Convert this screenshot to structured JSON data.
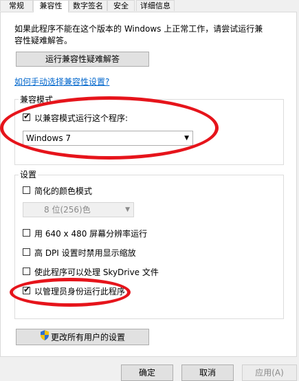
{
  "tabs": [
    {
      "label": "常规"
    },
    {
      "label": "兼容性"
    },
    {
      "label": "数字签名"
    },
    {
      "label": "安全"
    },
    {
      "label": "详细信息"
    }
  ],
  "intro": {
    "line1": "如果此程序不能在这个版本的 Windows 上正常工作，请尝试运行兼",
    "line2": "容性疑难解答。"
  },
  "troubleshoot_button": "运行兼容性疑难解答",
  "manual_link": "如何手动选择兼容性设置?",
  "compat_mode": {
    "title": "兼容模式",
    "checkbox_label": "以兼容模式运行这个程序:",
    "checked": true,
    "os_selected": "Windows 7"
  },
  "settings": {
    "title": "设置",
    "reduced_color": {
      "label": "简化的颜色模式",
      "checked": false
    },
    "color_select": "8 位(256)色",
    "res_640": {
      "label": "用 640 x 480 屏幕分辨率运行",
      "checked": false
    },
    "high_dpi": {
      "label": "高 DPI 设置时禁用显示缩放",
      "checked": false
    },
    "skydrive": {
      "label": "使此程序可以处理 SkyDrive 文件",
      "checked": false
    },
    "run_admin": {
      "label": "以管理员身份运行此程序",
      "checked": true
    }
  },
  "all_users_button": "更改所有用户的设置",
  "buttons": {
    "ok": "确定",
    "cancel": "取消",
    "apply": "应用(A)"
  },
  "colors": {
    "highlight_ellipse": "#e6141b",
    "link": "#0066cc",
    "shield_blue": "#2f6fd1",
    "shield_yellow": "#f4c20d"
  }
}
